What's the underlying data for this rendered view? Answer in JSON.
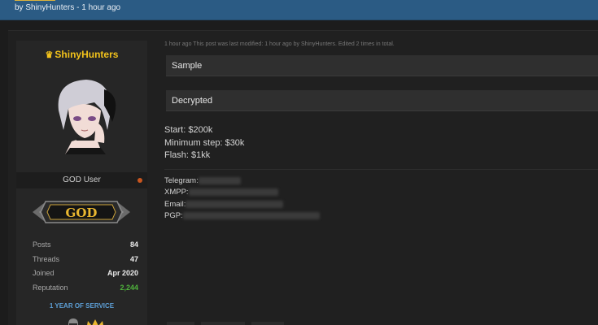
{
  "thread": {
    "byline": "by ShinyHunters - 1 hour ago"
  },
  "author": {
    "name": "ShinyHunters",
    "crown_icon": "crown-icon",
    "usertitle": "GOD User",
    "status_color": "#c9561f",
    "badge_text": "GOD",
    "stats": [
      {
        "label": "Posts",
        "value": "84"
      },
      {
        "label": "Threads",
        "value": "47"
      },
      {
        "label": "Joined",
        "value": "Apr 2020"
      },
      {
        "label": "Reputation",
        "value": "2,244"
      }
    ],
    "service_label": "1 YEAR OF SERVICE",
    "award_icons": [
      "knight-helmet-icon",
      "crown-icon"
    ]
  },
  "post": {
    "meta": "1 hour ago   This post was last modified: 1 hour ago by ShinyHunters. Edited 2 times in total.",
    "spoilers": [
      "Sample",
      "Decrypted"
    ],
    "lines": [
      "Start: $200k",
      "Minimum step: $30k",
      "Flash: $1kk"
    ],
    "contacts": [
      {
        "label": "Telegram:"
      },
      {
        "label": "XMPP:"
      },
      {
        "label": "Email:"
      },
      {
        "label": "PGP:"
      }
    ]
  },
  "colors": {
    "banner": "#2b5b84",
    "username": "#f2c21b",
    "reputation": "#4fb43c",
    "service": "#5d9fd6"
  }
}
